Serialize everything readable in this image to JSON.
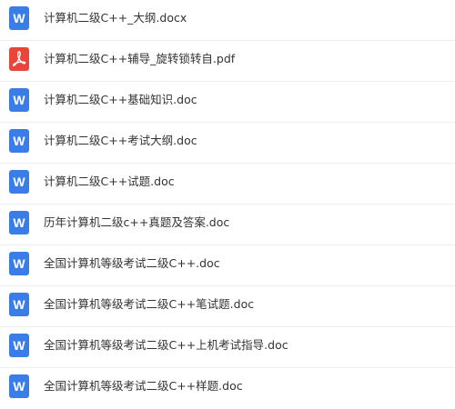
{
  "files": [
    {
      "name": "计算机二级C++_大纲.docx",
      "type": "word",
      "icon": "word-doc-icon"
    },
    {
      "name": "计算机二级C++辅导_旋转锁转自.pdf",
      "type": "pdf",
      "icon": "pdf-icon"
    },
    {
      "name": "计算机二级C++基础知识.doc",
      "type": "word",
      "icon": "word-doc-icon"
    },
    {
      "name": "计算机二级C++考试大纲.doc",
      "type": "word",
      "icon": "word-doc-icon"
    },
    {
      "name": "计算机二级C++试题.doc",
      "type": "word",
      "icon": "word-doc-icon"
    },
    {
      "name": "历年计算机二级c++真题及答案.doc",
      "type": "word",
      "icon": "word-doc-icon"
    },
    {
      "name": "全国计算机等级考试二级C++.doc",
      "type": "word",
      "icon": "word-doc-icon"
    },
    {
      "name": "全国计算机等级考试二级C++笔试题.doc",
      "type": "word",
      "icon": "word-doc-icon"
    },
    {
      "name": "全国计算机等级考试二级C++上机考试指导.doc",
      "type": "word",
      "icon": "word-doc-icon"
    },
    {
      "name": "全国计算机等级考试二级C++样题.doc",
      "type": "word",
      "icon": "word-doc-icon"
    }
  ],
  "colors": {
    "word": "#3a7de8",
    "pdf": "#e8463a",
    "text": "#333333",
    "divider": "#eeeeee"
  }
}
